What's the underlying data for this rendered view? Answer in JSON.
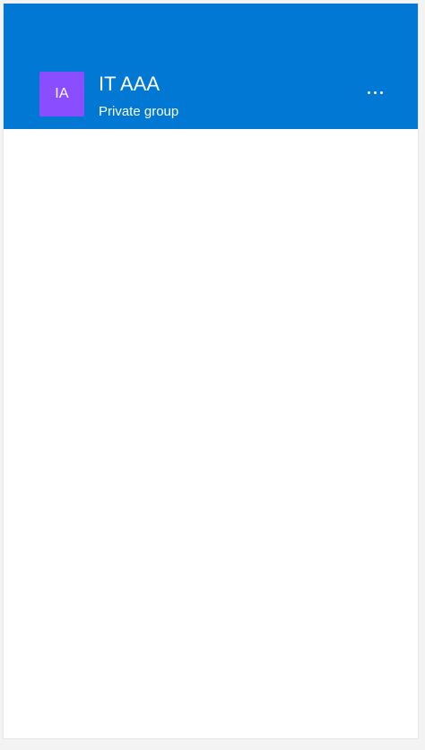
{
  "group": {
    "initials": "IA",
    "name": "IT AAA",
    "privacy": "Private group",
    "avatar_color": "#8a4dff"
  },
  "header": {
    "background_color": "#0078d4",
    "more_icon": "more-horizontal-icon"
  }
}
